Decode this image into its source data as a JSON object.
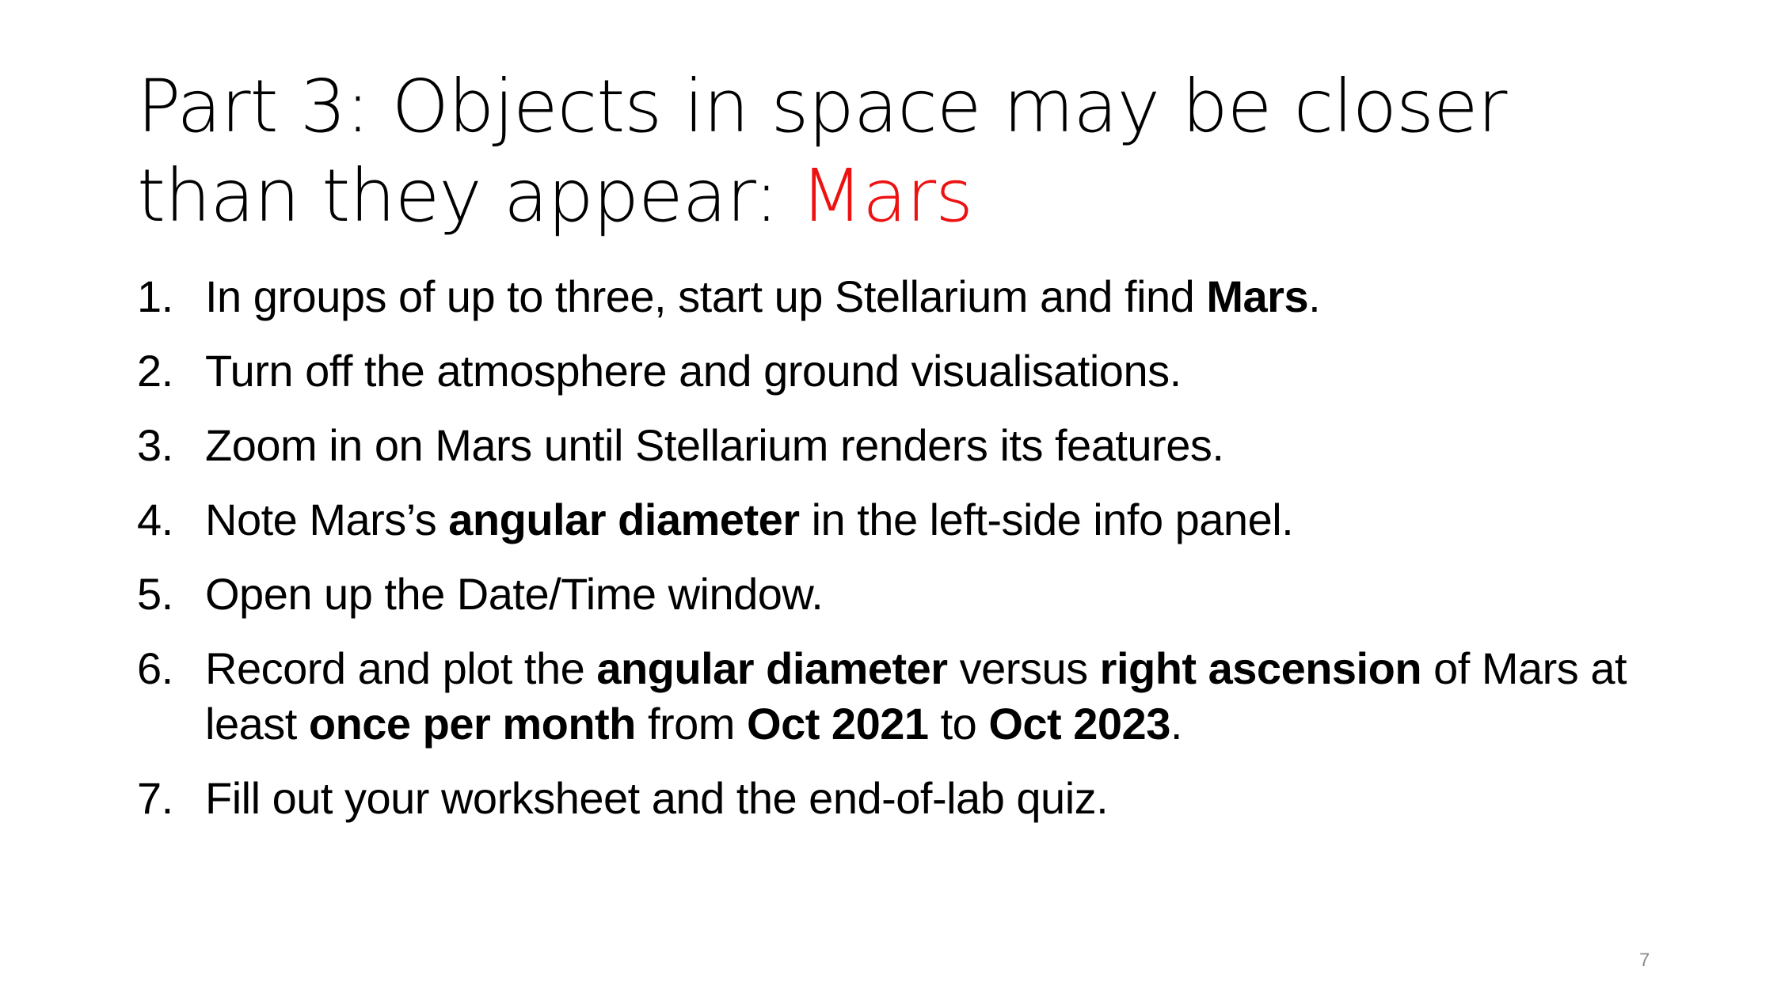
{
  "title": {
    "main": "Part 3: Objects in space may be closer than they appear: ",
    "accent": "Mars",
    "accent_color": "#ee1111"
  },
  "steps": [
    {
      "num": "1.",
      "segments": [
        {
          "text": "In groups of up to three, start up Stellarium and find ",
          "bold": false
        },
        {
          "text": "Mars",
          "bold": true
        },
        {
          "text": ".",
          "bold": false
        }
      ]
    },
    {
      "num": "2.",
      "segments": [
        {
          "text": "Turn off the atmosphere and ground visualisations.",
          "bold": false
        }
      ]
    },
    {
      "num": "3.",
      "segments": [
        {
          "text": "Zoom in on Mars until Stellarium renders its features.",
          "bold": false
        }
      ]
    },
    {
      "num": "4.",
      "segments": [
        {
          "text": "Note Mars’s ",
          "bold": false
        },
        {
          "text": "angular diameter",
          "bold": true
        },
        {
          "text": " in the left-side info panel.",
          "bold": false
        }
      ]
    },
    {
      "num": "5.",
      "segments": [
        {
          "text": "Open up the Date/Time window.",
          "bold": false
        }
      ]
    },
    {
      "num": "6.",
      "segments": [
        {
          "text": "Record and plot the ",
          "bold": false
        },
        {
          "text": "angular diameter",
          "bold": true
        },
        {
          "text": " versus ",
          "bold": false
        },
        {
          "text": "right ascension",
          "bold": true
        },
        {
          "text": " of Mars at least ",
          "bold": false
        },
        {
          "text": "once per month",
          "bold": true
        },
        {
          "text": " from ",
          "bold": false
        },
        {
          "text": "Oct 2021",
          "bold": true
        },
        {
          "text": " to ",
          "bold": false
        },
        {
          "text": "Oct 2023",
          "bold": true
        },
        {
          "text": ".",
          "bold": false
        }
      ]
    },
    {
      "num": "7.",
      "segments": [
        {
          "text": "Fill out your worksheet and the end-of-lab quiz.",
          "bold": false
        }
      ]
    }
  ],
  "page_number": "7"
}
